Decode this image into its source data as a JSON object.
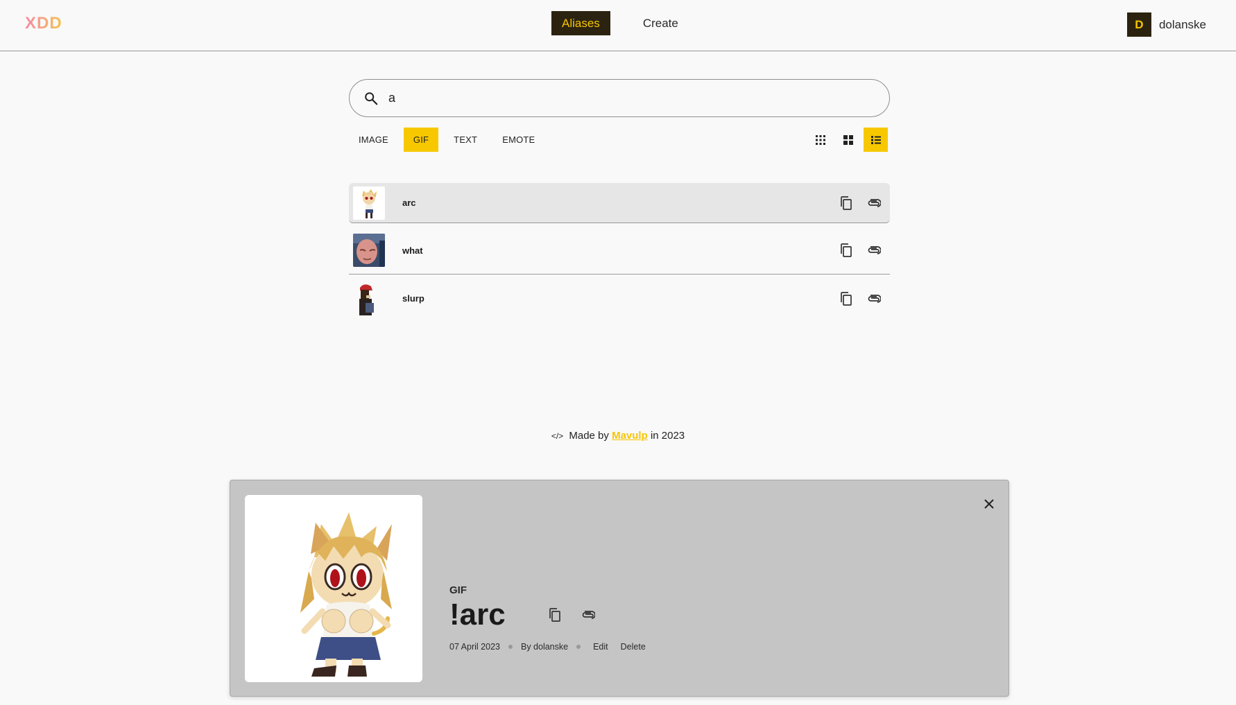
{
  "header": {
    "logo": "XDD",
    "nav": [
      {
        "label": "Aliases",
        "active": true
      },
      {
        "label": "Create",
        "active": false
      }
    ],
    "user": {
      "initial": "D",
      "name": "dolanske"
    }
  },
  "search": {
    "value": "a",
    "placeholder": ""
  },
  "filters": [
    {
      "label": "IMAGE",
      "active": false
    },
    {
      "label": "GIF",
      "active": true
    },
    {
      "label": "TEXT",
      "active": false
    },
    {
      "label": "EMOTE",
      "active": false
    }
  ],
  "view_modes": [
    {
      "icon": "small-grid-icon",
      "active": false
    },
    {
      "icon": "large-grid-icon",
      "active": false
    },
    {
      "icon": "list-view-icon",
      "active": true
    }
  ],
  "aliases": [
    {
      "name": "arc",
      "selected": true
    },
    {
      "name": "what",
      "selected": false
    },
    {
      "name": "slurp",
      "selected": false
    }
  ],
  "footer": {
    "prefix": "Made by",
    "author": "Mavulp",
    "suffix": "in 2023"
  },
  "detail": {
    "kind": "GIF",
    "title": "!arc",
    "date": "07 April 2023",
    "author": "By dolanske",
    "edit_label": "Edit",
    "delete_label": "Delete"
  },
  "colors": {
    "accent": "#f7c800",
    "dark": "#2b2310",
    "panel": "#c5c5c5"
  }
}
